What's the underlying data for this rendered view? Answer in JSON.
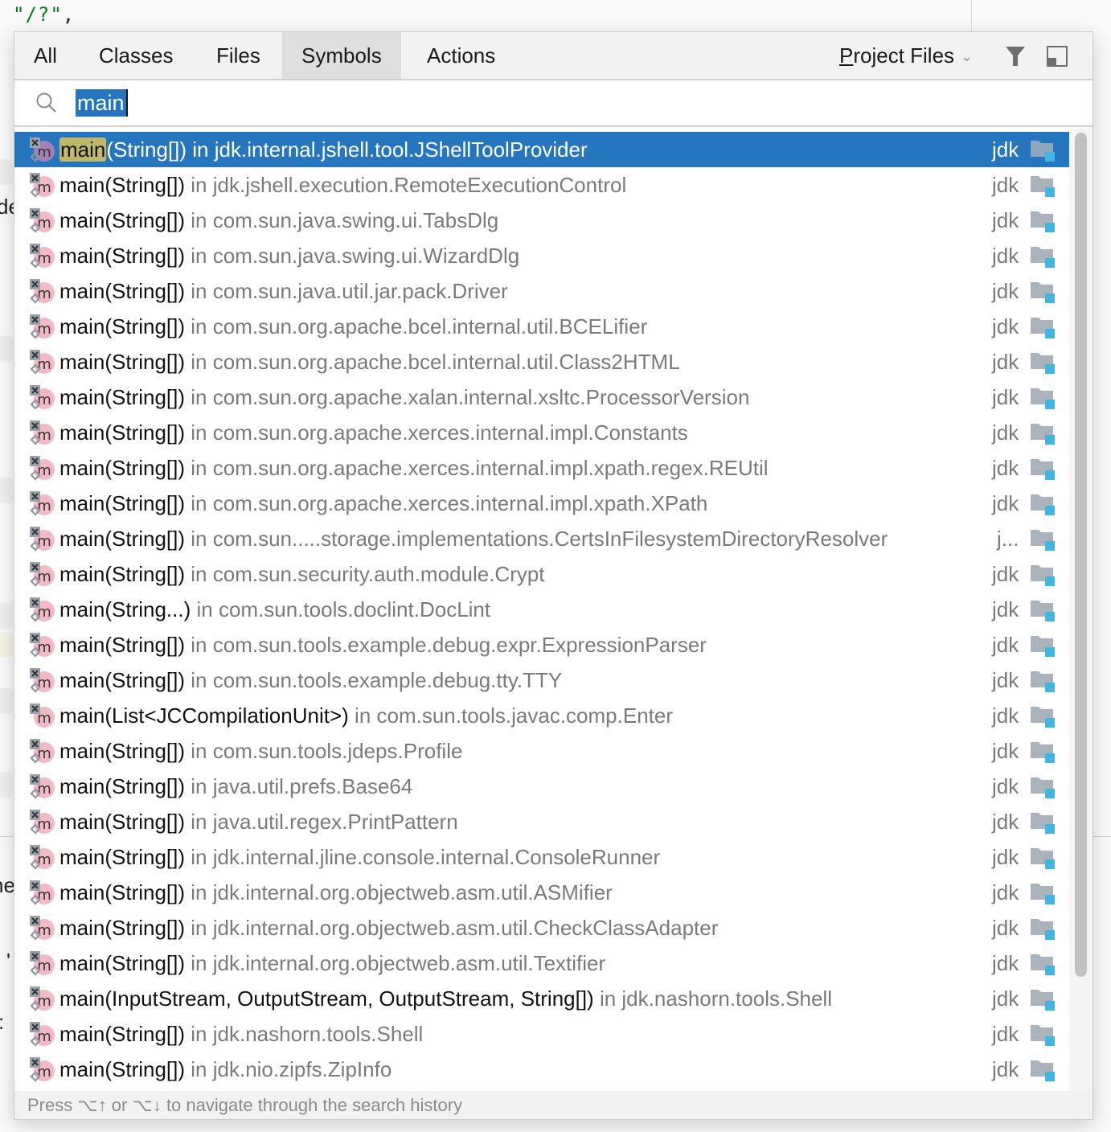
{
  "editor": {
    "code_line": "\"/?\"",
    "code_comma": ",",
    "fragments": [
      "de",
      "ne",
      "'",
      ":"
    ]
  },
  "popup": {
    "tabs": [
      {
        "label": "All",
        "active": false
      },
      {
        "label": "Classes",
        "active": false
      },
      {
        "label": "Files",
        "active": false
      },
      {
        "label": "Symbols",
        "active": true
      },
      {
        "label": "Actions",
        "active": false
      }
    ],
    "scope": {
      "mnemonic": "P",
      "rest": "roject Files",
      "icon": "chevron-down-icon"
    },
    "filter_icon": "filter-icon",
    "preview_icon": "preview-panel-icon",
    "search": {
      "value": "main",
      "icon": "search-icon"
    },
    "results": [
      {
        "name": "main",
        "sig": "(String[])",
        "loc": "in jdk.internal.jshell.tool.JShellToolProvider",
        "lib": "jdk",
        "selected": true,
        "diamond": true
      },
      {
        "name": "main",
        "sig": "(String[])",
        "loc": "in jdk.jshell.execution.RemoteExecutionControl",
        "lib": "jdk",
        "selected": false,
        "diamond": true
      },
      {
        "name": "main",
        "sig": "(String[])",
        "loc": "in com.sun.java.swing.ui.TabsDlg",
        "lib": "jdk",
        "selected": false,
        "diamond": true
      },
      {
        "name": "main",
        "sig": "(String[])",
        "loc": "in com.sun.java.swing.ui.WizardDlg",
        "lib": "jdk",
        "selected": false,
        "diamond": true
      },
      {
        "name": "main",
        "sig": "(String[])",
        "loc": "in com.sun.java.util.jar.pack.Driver",
        "lib": "jdk",
        "selected": false,
        "diamond": true
      },
      {
        "name": "main",
        "sig": "(String[])",
        "loc": "in com.sun.org.apache.bcel.internal.util.BCELifier",
        "lib": "jdk",
        "selected": false,
        "diamond": true
      },
      {
        "name": "main",
        "sig": "(String[])",
        "loc": "in com.sun.org.apache.bcel.internal.util.Class2HTML",
        "lib": "jdk",
        "selected": false,
        "diamond": true
      },
      {
        "name": "main",
        "sig": "(String[])",
        "loc": "in com.sun.org.apache.xalan.internal.xsltc.ProcessorVersion",
        "lib": "jdk",
        "selected": false,
        "diamond": true
      },
      {
        "name": "main",
        "sig": "(String[])",
        "loc": "in com.sun.org.apache.xerces.internal.impl.Constants",
        "lib": "jdk",
        "selected": false,
        "diamond": true
      },
      {
        "name": "main",
        "sig": "(String[])",
        "loc": "in com.sun.org.apache.xerces.internal.impl.xpath.regex.REUtil",
        "lib": "jdk",
        "selected": false,
        "diamond": true
      },
      {
        "name": "main",
        "sig": "(String[])",
        "loc": "in com.sun.org.apache.xerces.internal.impl.xpath.XPath",
        "lib": "jdk",
        "selected": false,
        "diamond": true
      },
      {
        "name": "main",
        "sig": "(String[])",
        "loc": "in com.sun.....storage.implementations.CertsInFilesystemDirectoryResolver",
        "lib": "j...",
        "selected": false,
        "diamond": true
      },
      {
        "name": "main",
        "sig": "(String[])",
        "loc": "in com.sun.security.auth.module.Crypt",
        "lib": "jdk",
        "selected": false,
        "diamond": true
      },
      {
        "name": "main",
        "sig": "(String...)",
        "loc": "in com.sun.tools.doclint.DocLint",
        "lib": "jdk",
        "selected": false,
        "diamond": true
      },
      {
        "name": "main",
        "sig": "(String[])",
        "loc": "in com.sun.tools.example.debug.expr.ExpressionParser",
        "lib": "jdk",
        "selected": false,
        "diamond": true
      },
      {
        "name": "main",
        "sig": "(String[])",
        "loc": "in com.sun.tools.example.debug.tty.TTY",
        "lib": "jdk",
        "selected": false,
        "diamond": true
      },
      {
        "name": "main",
        "sig": "(List<JCCompilationUnit>)",
        "loc": "in com.sun.tools.javac.comp.Enter",
        "lib": "jdk",
        "selected": false,
        "diamond": false
      },
      {
        "name": "main",
        "sig": "(String[])",
        "loc": "in com.sun.tools.jdeps.Profile",
        "lib": "jdk",
        "selected": false,
        "diamond": true
      },
      {
        "name": "main",
        "sig": "(String[])",
        "loc": "in java.util.prefs.Base64",
        "lib": "jdk",
        "selected": false,
        "diamond": true
      },
      {
        "name": "main",
        "sig": "(String[])",
        "loc": "in java.util.regex.PrintPattern",
        "lib": "jdk",
        "selected": false,
        "diamond": true
      },
      {
        "name": "main",
        "sig": "(String[])",
        "loc": "in jdk.internal.jline.console.internal.ConsoleRunner",
        "lib": "jdk",
        "selected": false,
        "diamond": true
      },
      {
        "name": "main",
        "sig": "(String[])",
        "loc": "in jdk.internal.org.objectweb.asm.util.ASMifier",
        "lib": "jdk",
        "selected": false,
        "diamond": true
      },
      {
        "name": "main",
        "sig": "(String[])",
        "loc": "in jdk.internal.org.objectweb.asm.util.CheckClassAdapter",
        "lib": "jdk",
        "selected": false,
        "diamond": true
      },
      {
        "name": "main",
        "sig": "(String[])",
        "loc": "in jdk.internal.org.objectweb.asm.util.Textifier",
        "lib": "jdk",
        "selected": false,
        "diamond": true
      },
      {
        "name": "main",
        "sig": "(InputStream, OutputStream, OutputStream, String[])",
        "loc": "in jdk.nashorn.tools.Shell",
        "lib": "jdk",
        "selected": false,
        "diamond": true
      },
      {
        "name": "main",
        "sig": "(String[])",
        "loc": "in jdk.nashorn.tools.Shell",
        "lib": "jdk",
        "selected": false,
        "diamond": true
      },
      {
        "name": "main",
        "sig": "(String[])",
        "loc": "in jdk.nio.zipfs.ZipInfo",
        "lib": "jdk",
        "selected": false,
        "diamond": true
      }
    ],
    "footer_hint": "Press ⌥↑ or ⌥↓ to navigate through the search history"
  },
  "colors": {
    "selection": "#2675bf",
    "match_highlight": "#bfb86a",
    "method_icon": "#f4b9c6",
    "module_badge": "#40b6e0",
    "folder": "#aab3bb"
  }
}
